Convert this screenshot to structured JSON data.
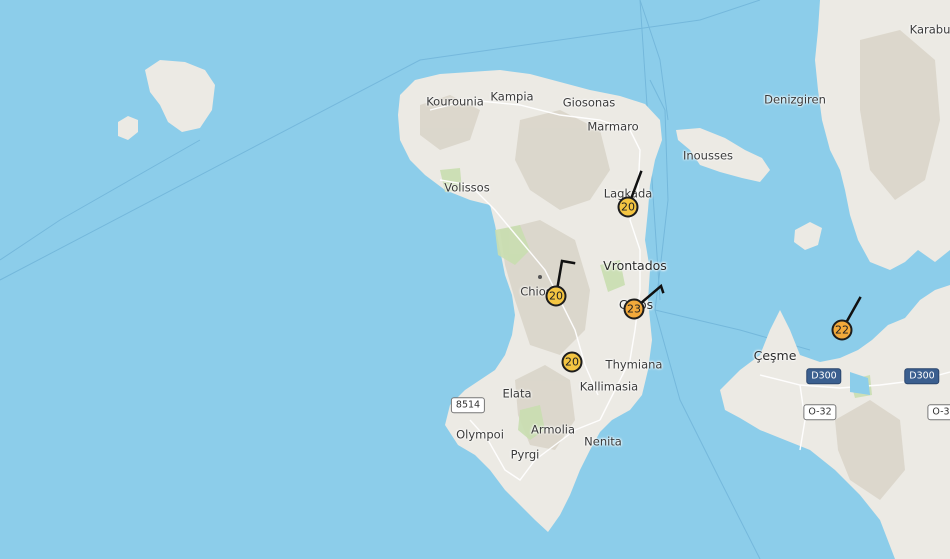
{
  "colors": {
    "sea": "#8ccdea",
    "land": "#eceae4",
    "land_shade": "#d9d4c8",
    "park_green": "#c9deb0",
    "marker_yellow": "#f4c542",
    "marker_orange": "#f2a93b",
    "route_blue": "#6fb3d8"
  },
  "places": {
    "kourounia": "Kourounia",
    "kampia": "Kampia",
    "giosonas": "Giosonas",
    "marmaro": "Marmaro",
    "inousses": "Inousses",
    "denizgiren": "Denizgiren",
    "karaburun": "Karabu",
    "volissos": "Volissos",
    "lagkada": "Lagkada",
    "vrontados": "Vrontados",
    "chios": "Chios",
    "chios_town": "Chios",
    "cesme": "Çeşme",
    "thymiana": "Thymiana",
    "kallimasia": "Kallimasia",
    "elata": "Elata",
    "olympoi": "Olympoi",
    "armolia": "Armolia",
    "nenita": "Nenita",
    "pyrgi": "Pyrgi"
  },
  "roads": {
    "r8514": "8514",
    "d300_a": "D300",
    "d300_b": "D300",
    "o32_a": "O-32",
    "o32_b": "O-3"
  },
  "markers": [
    {
      "id": "lagkada",
      "value": "20",
      "icon": "wind-barb-icon",
      "color": "#f4c542"
    },
    {
      "id": "chios-center",
      "value": "20",
      "icon": "wind-barb-icon",
      "color": "#f4c542"
    },
    {
      "id": "chios-town",
      "value": "23",
      "icon": "wind-barb-icon",
      "color": "#f2a93b"
    },
    {
      "id": "kallimasia",
      "value": "20",
      "icon": "wind-barb-icon",
      "color": "#f4c542"
    },
    {
      "id": "cesme",
      "value": "22",
      "icon": "wind-barb-icon",
      "color": "#f2a93b"
    }
  ]
}
